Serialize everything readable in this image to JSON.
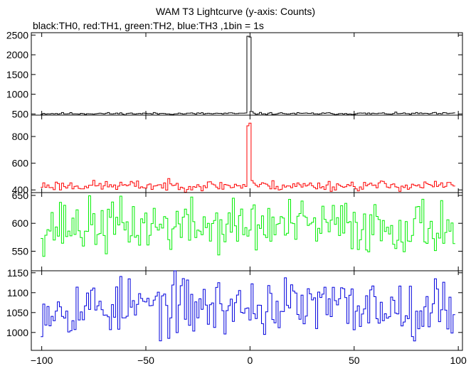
{
  "chart_data": {
    "type": "line",
    "title": "WAM T3 Lightcurve (y-axis: Counts)",
    "subtitle": "black:TH0, red:TH1, green:TH2, blue:TH3 ,1bin = 1s",
    "xlabel": "",
    "xlim": [
      -105,
      102
    ],
    "x_ticks": [
      -100,
      -50,
      0,
      50,
      100
    ],
    "x_tick_labels": [
      "−100",
      "−50",
      "0",
      "50",
      "100"
    ],
    "grid": false,
    "panels": [
      {
        "name": "TH0",
        "color": "#000000",
        "ylim": [
          470,
          2560
        ],
        "y_ticks": [
          500,
          1000,
          1500,
          2000,
          2500
        ],
        "y_tick_labels": [
          "500",
          "1000",
          "1500",
          "2000",
          "2500"
        ],
        "baseline": 510,
        "noise": 25,
        "seed": 11,
        "peak": [
          [
            -1,
            2470
          ],
          [
            0,
            2450
          ],
          [
            1,
            560
          ]
        ]
      },
      {
        "name": "TH1",
        "color": "#ff0000",
        "ylim": [
          380,
          960
        ],
        "y_ticks": [
          400,
          600,
          800
        ],
        "y_tick_labels": [
          "400",
          "600",
          "800"
        ],
        "baseline": 432,
        "noise": 38,
        "seed": 23,
        "peak": [
          [
            -1,
            880
          ],
          [
            0,
            900
          ],
          [
            1,
            470
          ],
          [
            2,
            450
          ]
        ]
      },
      {
        "name": "TH2",
        "color": "#00ee00",
        "ylim": [
          515,
          655
        ],
        "y_ticks": [
          550,
          600,
          650
        ],
        "y_tick_labels": [
          "550",
          "600",
          "650"
        ],
        "baseline": 595,
        "noise": 48,
        "seed": 37,
        "peak": []
      },
      {
        "name": "TH3",
        "color": "#0000dd",
        "ylim": [
          955,
          1155
        ],
        "y_ticks": [
          1000,
          1050,
          1100,
          1150
        ],
        "y_tick_labels": [
          "1000",
          "1050",
          "1100",
          "1150"
        ],
        "baseline": 1065,
        "noise": 72,
        "seed": 53,
        "peak": []
      }
    ]
  }
}
